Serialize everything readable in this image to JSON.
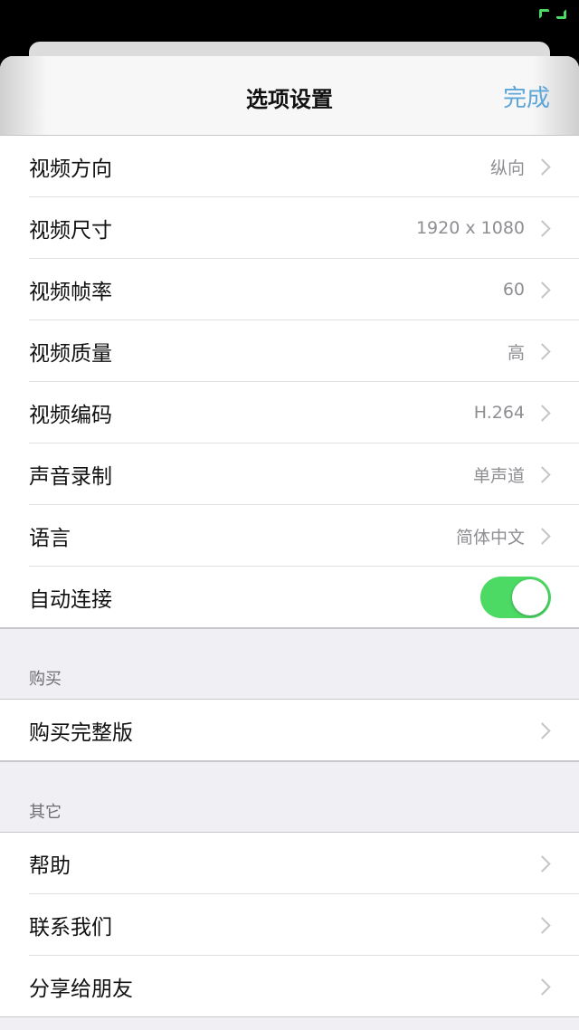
{
  "nav": {
    "title": "选项设置",
    "done_label": "完成"
  },
  "colors": {
    "accent": "#5ea5d8",
    "toggle_on": "#4cd964",
    "background": "#efeff4"
  },
  "settings": [
    {
      "label": "视频方向",
      "value": "纵向"
    },
    {
      "label": "视频尺寸",
      "value": "1920 x 1080"
    },
    {
      "label": "视频帧率",
      "value": "60"
    },
    {
      "label": "视频质量",
      "value": "高"
    },
    {
      "label": "视频编码",
      "value": "H.264"
    },
    {
      "label": "声音录制",
      "value": "单声道"
    },
    {
      "label": "语言",
      "value": "简体中文"
    }
  ],
  "auto_connect": {
    "label": "自动连接",
    "enabled": true
  },
  "purchase": {
    "header": "购买",
    "items": [
      {
        "label": "购买完整版"
      }
    ]
  },
  "other": {
    "header": "其它",
    "items": [
      {
        "label": "帮助"
      },
      {
        "label": "联系我们"
      },
      {
        "label": "分享给朋友"
      }
    ]
  }
}
